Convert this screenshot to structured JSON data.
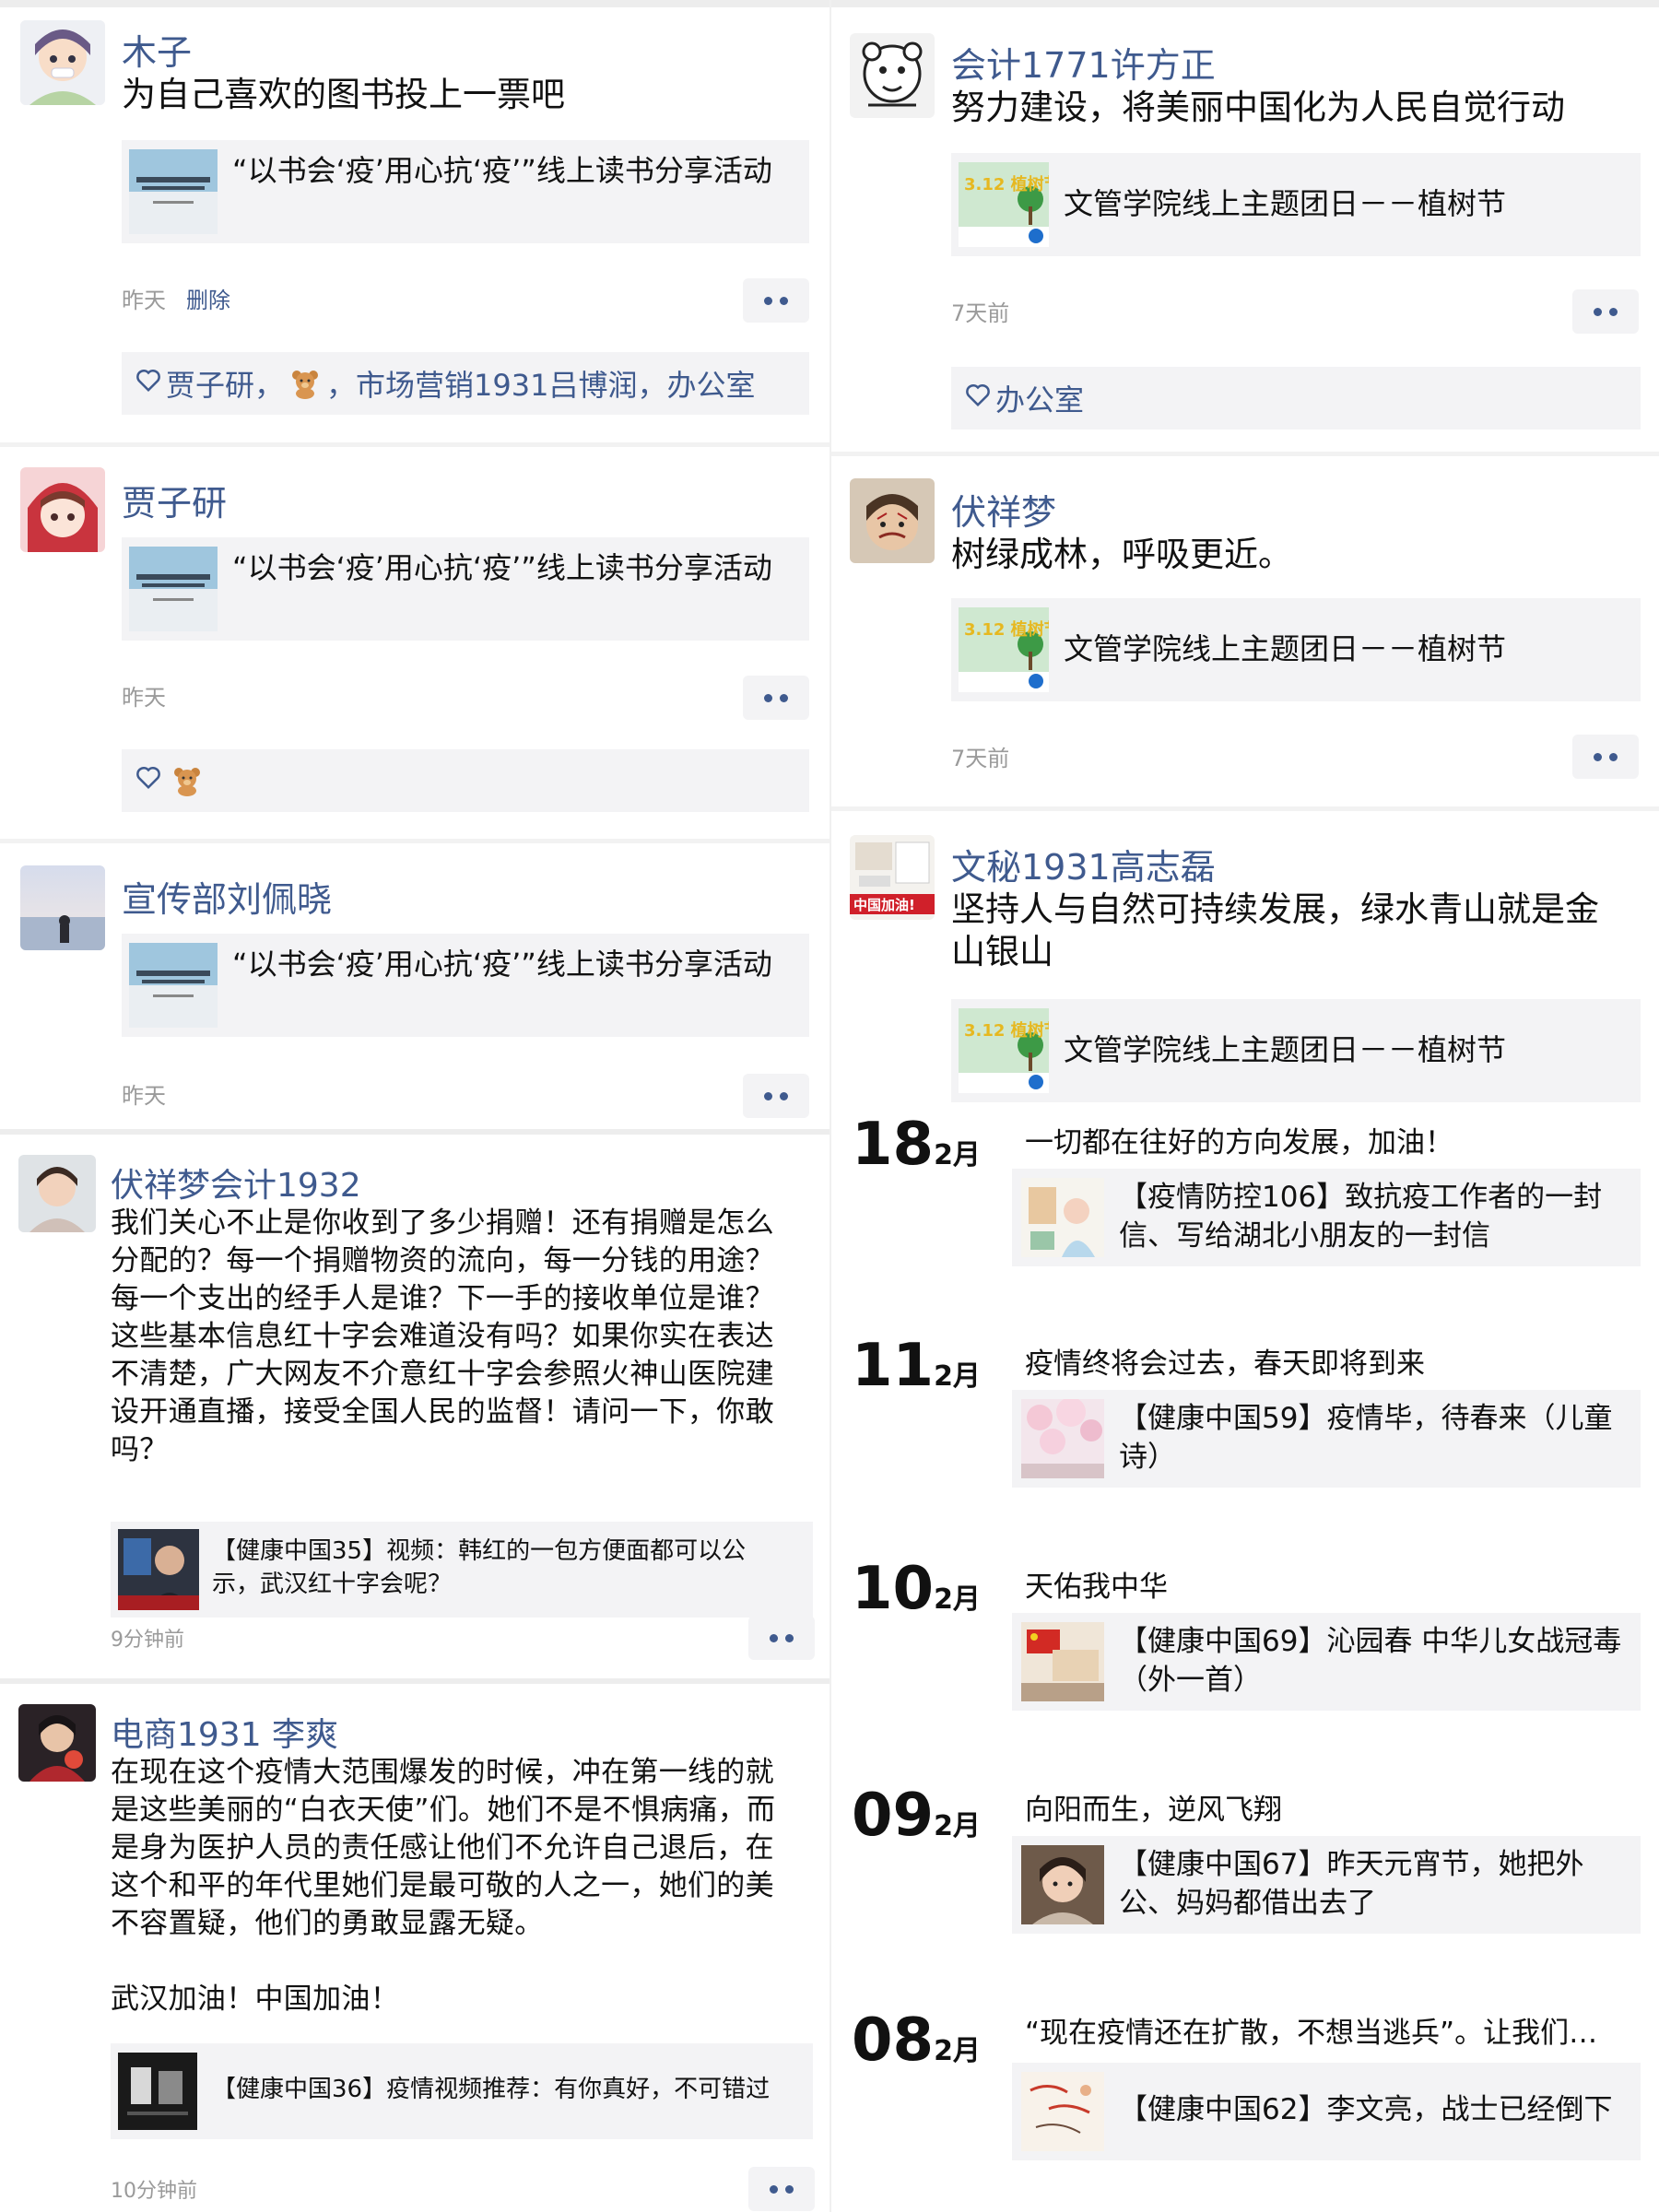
{
  "left_posts": [
    {
      "name": "木子",
      "text": "为自己喜欢的图书投上一票吧",
      "card_title": "“以书会‘疫’用心抗‘疫’”线上读书分享活动",
      "time": "昨天",
      "delete_label": "删除",
      "likes": {
        "before": "贾子研，",
        "after": "，市场营销1931吕博润，办公室"
      }
    },
    {
      "name": "贾子研",
      "card_title": "“以书会‘疫’用心抗‘疫’”线上读书分享活动",
      "time": "昨天"
    },
    {
      "name": "宣传部刘佩晓",
      "card_title": "“以书会‘疫’用心抗‘疫’”线上读书分享活动",
      "time": "昨天"
    },
    {
      "name": "伏祥梦会计1932",
      "text": "我们关心不止是你收到了多少捐赠！还有捐赠是怎么分配的？每一个捐赠物资的流向，每一分钱的用途？每一个支出的经手人是谁？下一手的接收单位是谁？这些基本信息红十字会难道没有吗？如果你实在表达不清楚，广大网友不介意红十字会参照火神山医院建设开通直播，接受全国人民的监督！请问一下，你敢吗？",
      "card_title": "【健康中国35】视频：韩红的一包方便面都可以公示，武汉红十字会呢？",
      "time": "9分钟前"
    },
    {
      "name": "电商1931 李爽",
      "text": "在现在这个疫情大范围爆发的时候，冲在第一线的就是这些美丽的“白衣天使”们。她们不是不惧病痛，而是身为医护人员的责任感让他们不允许自己退后，在这个和平的年代里她们是最可敬的人之一，她们的美不容置疑，他们的勇敢显露无疑。",
      "text2": "武汉加油！中国加油！",
      "card_title": "【健康中国36】疫情视频推荐：有你真好，不可错过",
      "time": "10分钟前"
    }
  ],
  "right_posts": [
    {
      "name": "会计1771许方正",
      "text": "努力建设，将美丽中国化为人民自觉行动",
      "card_title": "文管学院线上主题团日－－植树节",
      "time": "7天前",
      "likes": {
        "before": "办公室",
        "after": ""
      }
    },
    {
      "name": "伏祥梦",
      "text": "树绿成林，呼吸更近。",
      "card_title": "文管学院线上主题团日－－植树节",
      "time": "7天前"
    },
    {
      "name": "文秘1931高志磊",
      "text": "坚持人与自然可持续发展，绿水青山就是金山银山",
      "card_title": "文管学院线上主题团日－－植树节",
      "avatar_caption": "中国加油!"
    }
  ],
  "thumb_label": "3.12 植树节",
  "timeline": [
    {
      "day": "18",
      "month": "2月",
      "text": "一切都在往好的方向发展，加油！",
      "card_title": "【疫情防控106】致抗疫工作者的一封信、写给湖北小朋友的一封信"
    },
    {
      "day": "11",
      "month": "2月",
      "text": "疫情终将会过去，春天即将到来",
      "card_title": "【健康中国59】疫情毕，待春来（儿童诗）"
    },
    {
      "day": "10",
      "month": "2月",
      "text": "天佑我中华",
      "card_title": "【健康中国69】沁园春 中华儿女战冠毒（外一首）"
    },
    {
      "day": "09",
      "month": "2月",
      "text": "向阳而生，逆风飞翔",
      "card_title": "【健康中国67】昨天元宵节，她把外公、妈妈都借出去了"
    },
    {
      "day": "08",
      "month": "2月",
      "text": "“现在疫情还在扩散，不想当逃兵”。让我们…",
      "card_title": "【健康中国62】李文亮，战士已经倒下"
    }
  ],
  "colors": {
    "link": "#3f5a8e",
    "card_bg": "#f3f3f5",
    "meta": "#9a9a9a"
  }
}
